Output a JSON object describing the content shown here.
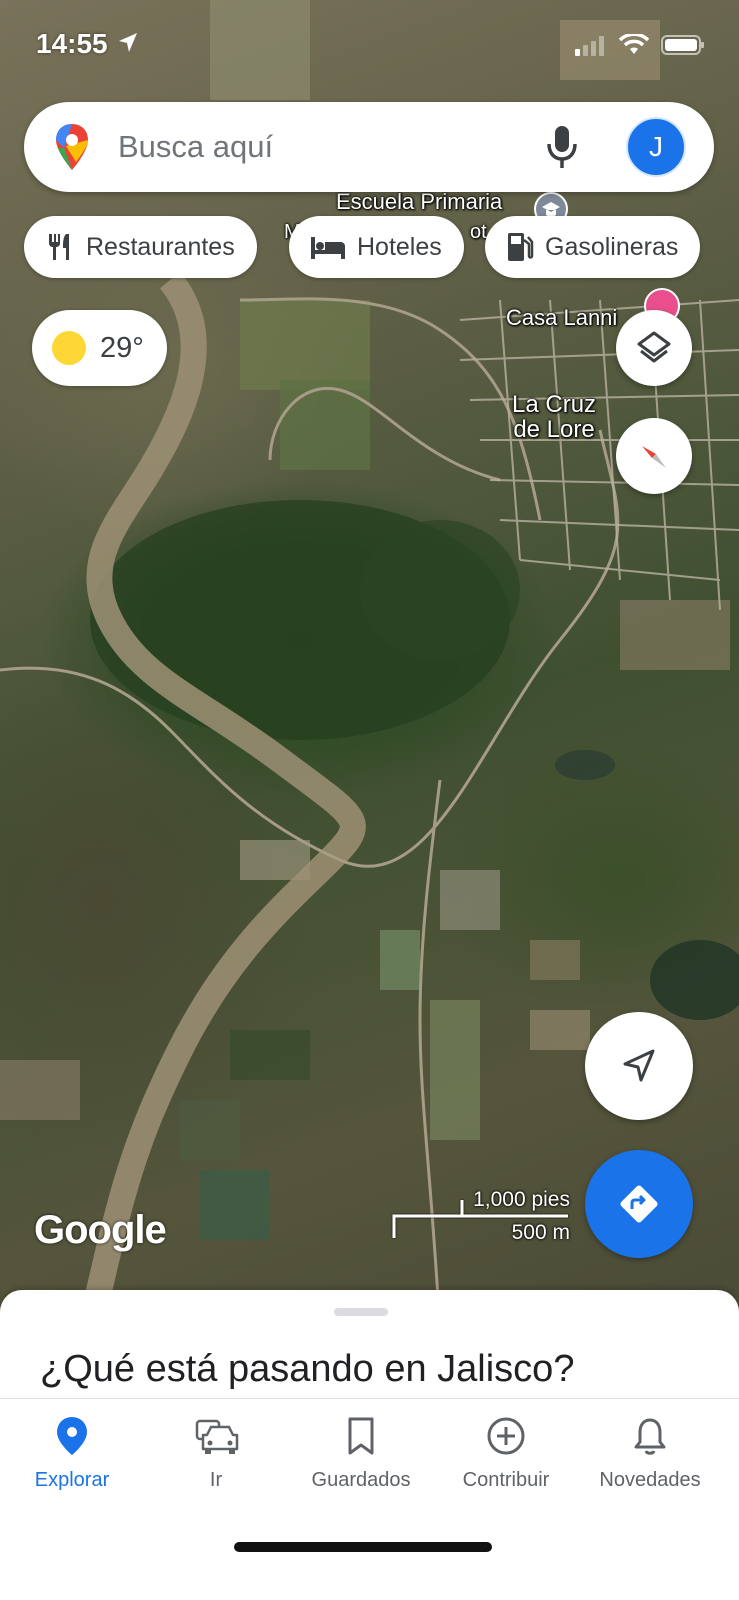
{
  "status_bar": {
    "time": "14:55",
    "icons": [
      "location-arrow-icon",
      "signal-icon",
      "wifi-icon",
      "battery-icon"
    ]
  },
  "search": {
    "placeholder": "Busca aquí",
    "avatar_initial": "J",
    "icons": [
      "google-maps-pin-icon",
      "microphone-icon"
    ]
  },
  "chips": [
    {
      "label": "Restaurantes",
      "icon": "fork-knife-icon"
    },
    {
      "label": "Hoteles",
      "icon": "bed-icon"
    },
    {
      "label": "Gasolineras",
      "icon": "gas-pump-icon"
    }
  ],
  "weather": {
    "temperature": "29°",
    "icon": "sun-icon"
  },
  "map": {
    "labels": {
      "school": "Escuela Primaria",
      "school_partial": "M",
      "school_partial2": "ot",
      "casa": "Casa Lanni",
      "town_line1": "La Cruz",
      "town_line2": "de Lore"
    },
    "type": "satellite",
    "watermark": "Google",
    "scale": {
      "imperial": "1,000 pies",
      "metric": "500 m"
    }
  },
  "sheet": {
    "title": "¿Qué está pasando en Jalisco?"
  },
  "nav": {
    "items": [
      {
        "label": "Explorar",
        "icon": "explore-pin-icon",
        "active": true
      },
      {
        "label": "Ir",
        "icon": "car-icon",
        "active": false
      },
      {
        "label": "Guardados",
        "icon": "bookmark-icon",
        "active": false
      },
      {
        "label": "Contribuir",
        "icon": "add-circle-icon",
        "active": false
      },
      {
        "label": "Novedades",
        "icon": "bell-icon",
        "active": false
      }
    ]
  },
  "colors": {
    "accent": "#1a73e8",
    "nav_inactive": "#5f6368",
    "weather_sun": "#fdd835"
  }
}
